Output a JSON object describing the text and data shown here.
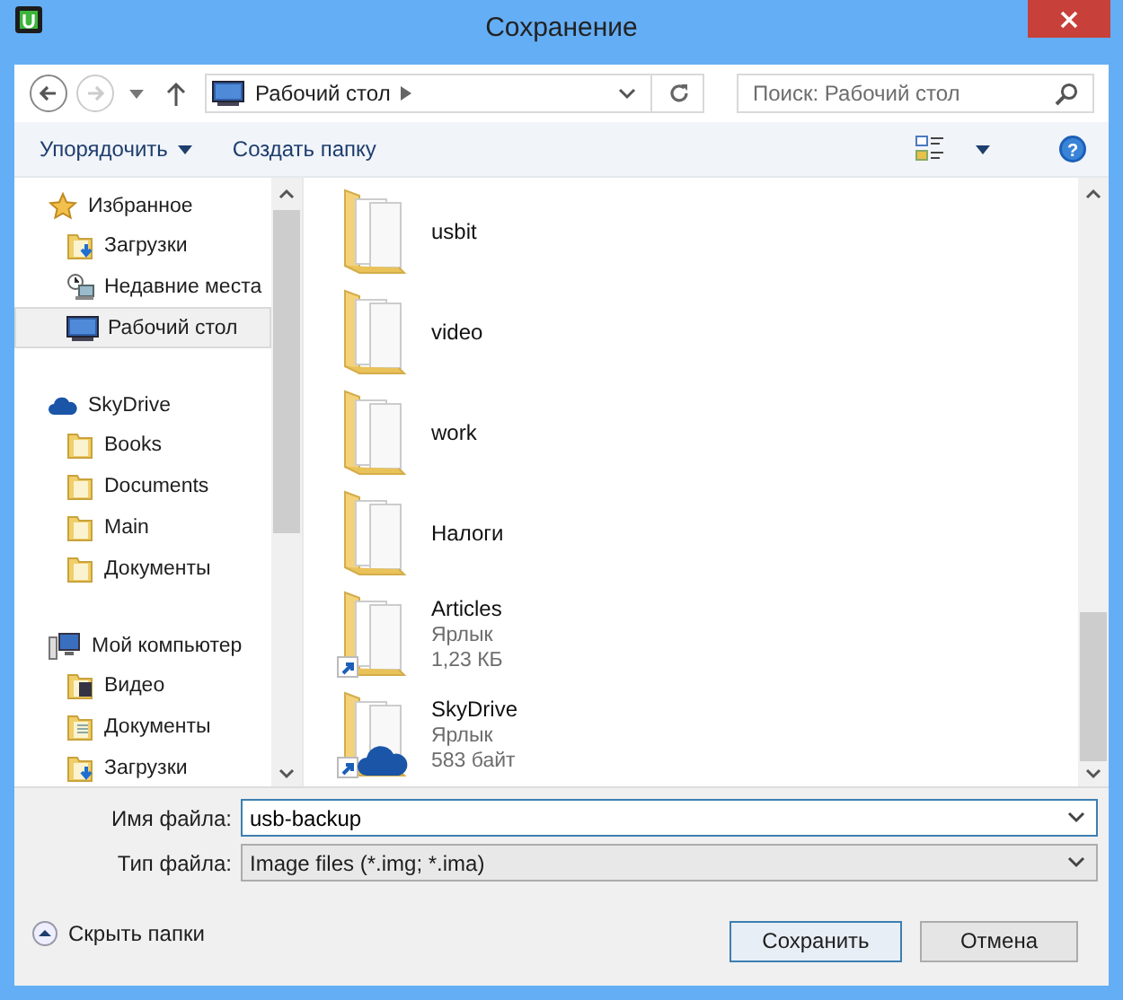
{
  "window": {
    "title": "Сохранение"
  },
  "nav": {
    "address": "Рабочий стол",
    "forward_disabled": true,
    "search": {
      "placeholder": "Поиск: Рабочий стол"
    }
  },
  "toolbar": {
    "organize": "Упорядочить",
    "new_folder": "Создать папку",
    "help": "?"
  },
  "sidebar": {
    "groups": [
      {
        "label": "Избранное",
        "kind": "favorites",
        "items": [
          {
            "label": "Загрузки",
            "kind": "downloads",
            "selected": false
          },
          {
            "label": "Недавние места",
            "kind": "recent",
            "selected": false
          },
          {
            "label": "Рабочий стол",
            "kind": "desktop",
            "selected": true
          }
        ]
      },
      {
        "label": "SkyDrive",
        "kind": "cloud",
        "items": [
          {
            "label": "Books",
            "kind": "folder",
            "selected": false
          },
          {
            "label": "Documents",
            "kind": "folder",
            "selected": false
          },
          {
            "label": "Main",
            "kind": "folder",
            "selected": false
          },
          {
            "label": "Документы",
            "kind": "folder",
            "selected": false
          }
        ]
      },
      {
        "label": "Мой компьютер",
        "kind": "computer",
        "items": [
          {
            "label": "Видео",
            "kind": "video",
            "selected": false
          },
          {
            "label": "Документы",
            "kind": "docs",
            "selected": false
          },
          {
            "label": "Загрузки",
            "kind": "downloads",
            "selected": false
          }
        ]
      }
    ]
  },
  "files": [
    {
      "name": "usbit",
      "kind": "folder"
    },
    {
      "name": "video",
      "kind": "folder"
    },
    {
      "name": "work",
      "kind": "folder"
    },
    {
      "name": "Налоги",
      "kind": "folder"
    },
    {
      "name": "Articles",
      "kind": "shortcut",
      "type": "Ярлык",
      "size": "1,23 КБ"
    },
    {
      "name": "SkyDrive",
      "kind": "cloud-shortcut",
      "type": "Ярлык",
      "size": "583 байт"
    }
  ],
  "fields": [
    {
      "label": "Имя файла:",
      "value": "usb-backup",
      "kind": "input"
    },
    {
      "label": "Тип файла:",
      "value": "Image files (*.img; *.ima)",
      "kind": "select"
    }
  ],
  "hide_folders": "Скрыть папки",
  "buttons": [
    {
      "label": "Сохранить",
      "default": true
    },
    {
      "label": "Отмена",
      "default": false
    }
  ]
}
